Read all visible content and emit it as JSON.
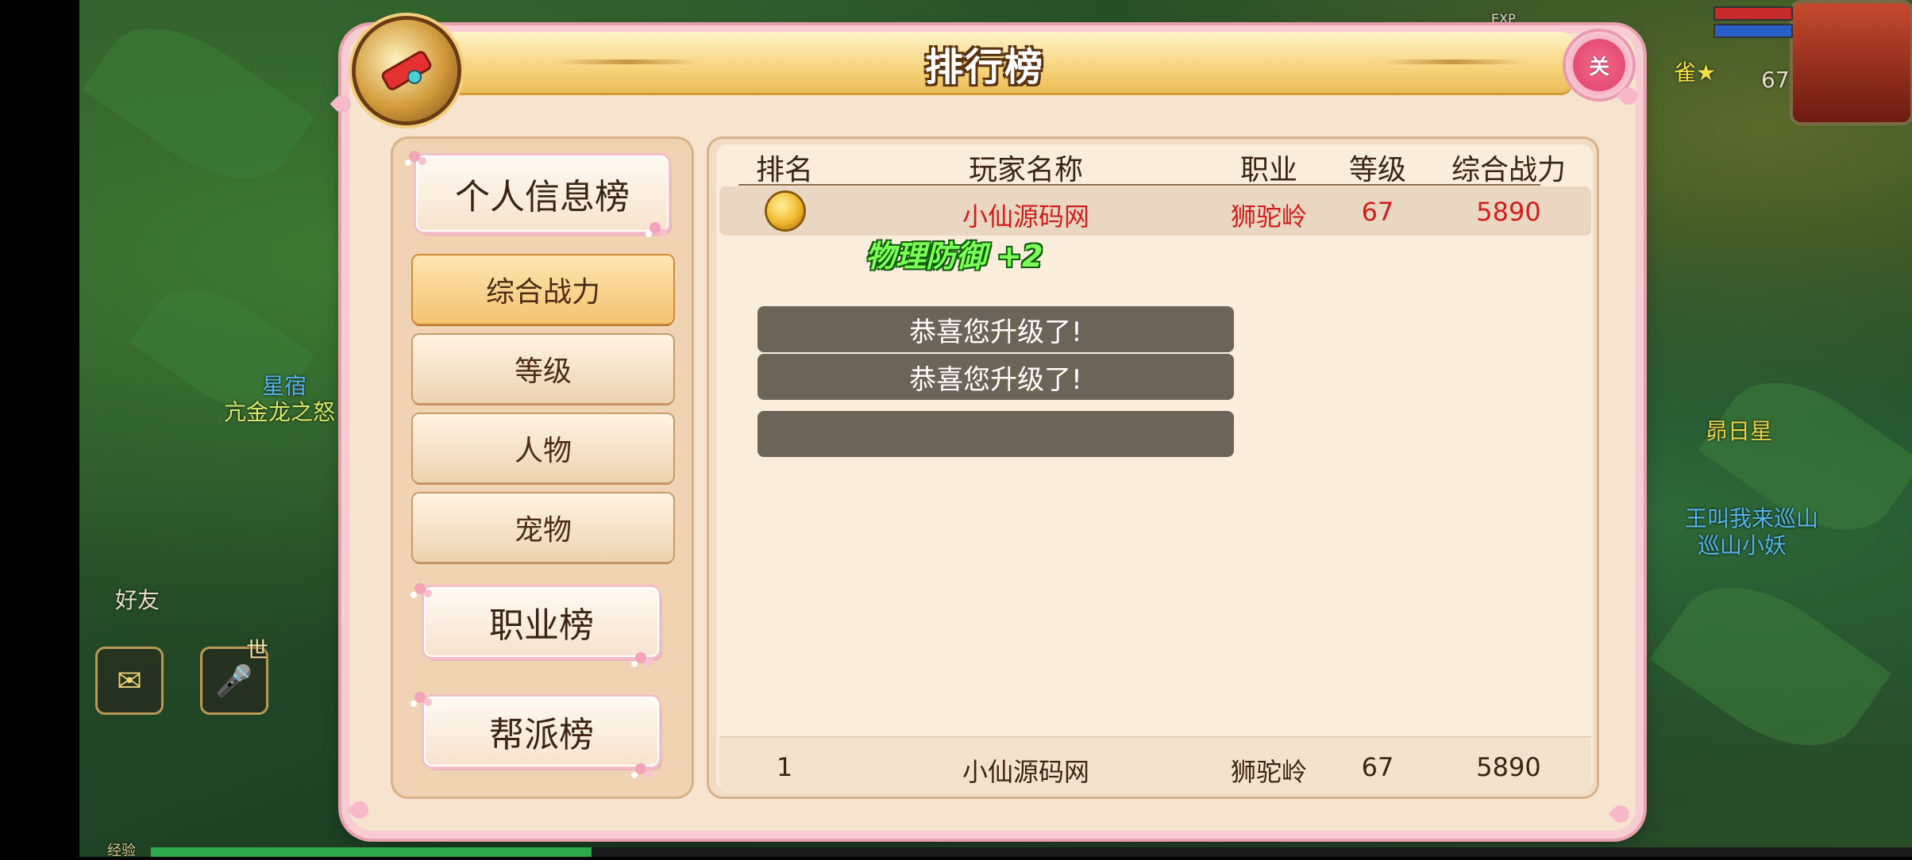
{
  "window": {
    "title": "排行榜",
    "close_label": "关"
  },
  "hud": {
    "npc_name_1": "星宿",
    "npc_title_1": "亢金龙之怒",
    "friends_label": "好友",
    "world_channel_label": "世",
    "exp_label": "EXP",
    "player_level": "67",
    "right_npc_1": "昴日星",
    "right_npc_2": "王叫我来巡山",
    "right_npc_3": "巡山小妖",
    "right_tag": "雀★",
    "exp_bar_label": "经验"
  },
  "sidebar": {
    "personal_info_tab": "个人信息榜",
    "sub_tabs": [
      "综合战力",
      "等级",
      "人物",
      "宠物"
    ],
    "active_sub_tab": "综合战力",
    "class_tab": "职业榜",
    "guild_tab": "帮派榜"
  },
  "table": {
    "columns": [
      "排名",
      "玩家名称",
      "职业",
      "等级",
      "综合战力"
    ],
    "rows": [
      {
        "rank": "1",
        "name": "小仙源码网",
        "class": "狮驼岭",
        "level": "67",
        "power": "5890"
      }
    ],
    "my_row": {
      "rank": "1",
      "name": "小仙源码网",
      "class": "狮驼岭",
      "level": "67",
      "power": "5890"
    }
  },
  "floating": {
    "buff_text": "物理防御 +2",
    "toasts": [
      "恭喜您升级了!",
      "恭喜您升级了!",
      ""
    ]
  },
  "colors": {
    "title_gold": "#f6d37a",
    "highlight_red": "#d11d1d",
    "buff_green": "#7cff57",
    "active_tab": "#f5c26f"
  }
}
